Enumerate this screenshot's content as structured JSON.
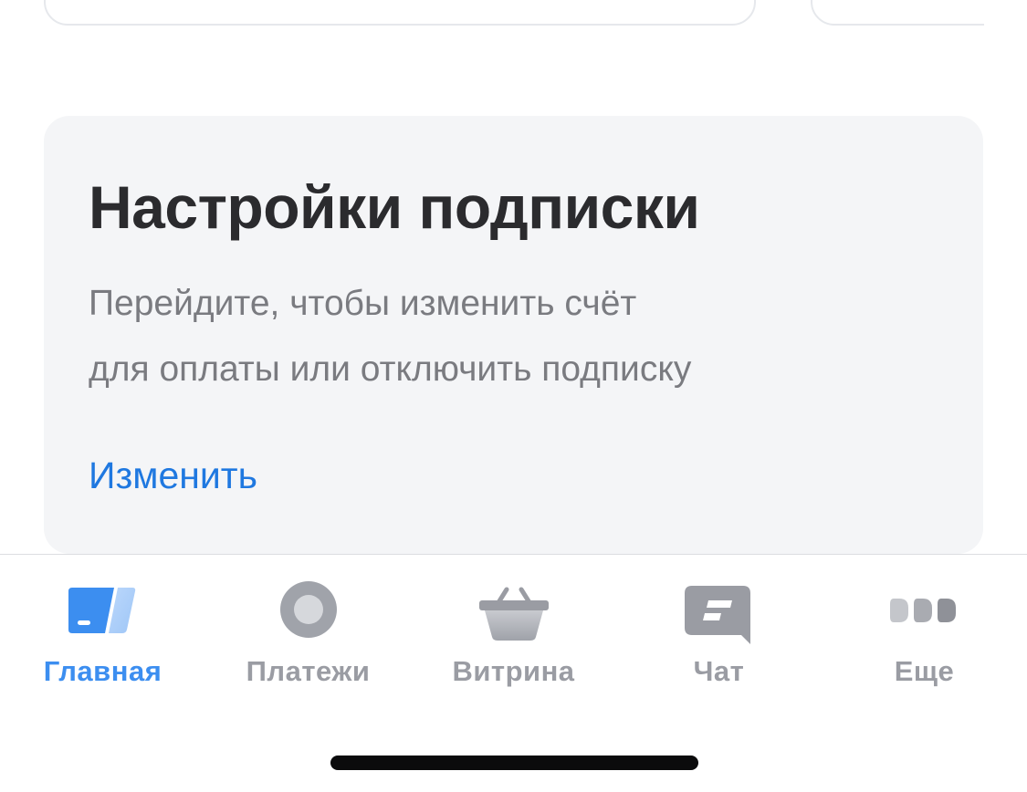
{
  "subscription": {
    "title": "Настройки подписки",
    "description_line1": "Перейдите, чтобы изменить счёт",
    "description_line2": "для оплаты или отключить подписку",
    "change_link": "Изменить"
  },
  "tab_bar": {
    "active_color": "#3c8ef0",
    "inactive_color": "#9a9ca3",
    "items": [
      {
        "label": "Главная",
        "icon": "card-icon",
        "active": true
      },
      {
        "label": "Платежи",
        "icon": "circle-icon",
        "active": false
      },
      {
        "label": "Витрина",
        "icon": "basket-icon",
        "active": false
      },
      {
        "label": "Чат",
        "icon": "chat-icon",
        "active": false
      },
      {
        "label": "Еще",
        "icon": "more-dots-icon",
        "active": false
      }
    ]
  }
}
